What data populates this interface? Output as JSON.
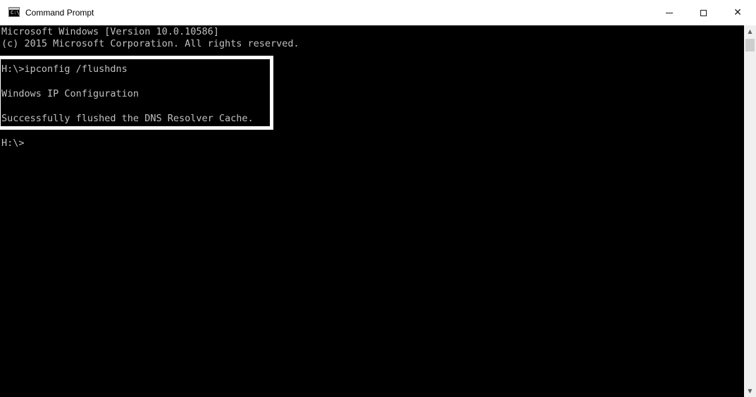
{
  "window": {
    "title": "Command Prompt",
    "icon": "cmd-icon",
    "icon_glyph": "C:\\",
    "controls": {
      "minimize": "minimize-icon",
      "maximize": "maximize-icon",
      "close_glyph": "✕"
    }
  },
  "console": {
    "lines": [
      "Microsoft Windows [Version 10.0.10586]",
      "(c) 2015 Microsoft Corporation. All rights reserved.",
      "H:\\>ipconfig /flushdns",
      "Windows IP Configuration",
      "Successfully flushed the DNS Resolver Cache.",
      "H:\\>"
    ]
  },
  "scrollbar": {
    "up_glyph": "▲",
    "down_glyph": "▼"
  },
  "colors": {
    "console_bg": "#000000",
    "console_text": "#c0c0c0",
    "highlight": "#ffffff"
  }
}
